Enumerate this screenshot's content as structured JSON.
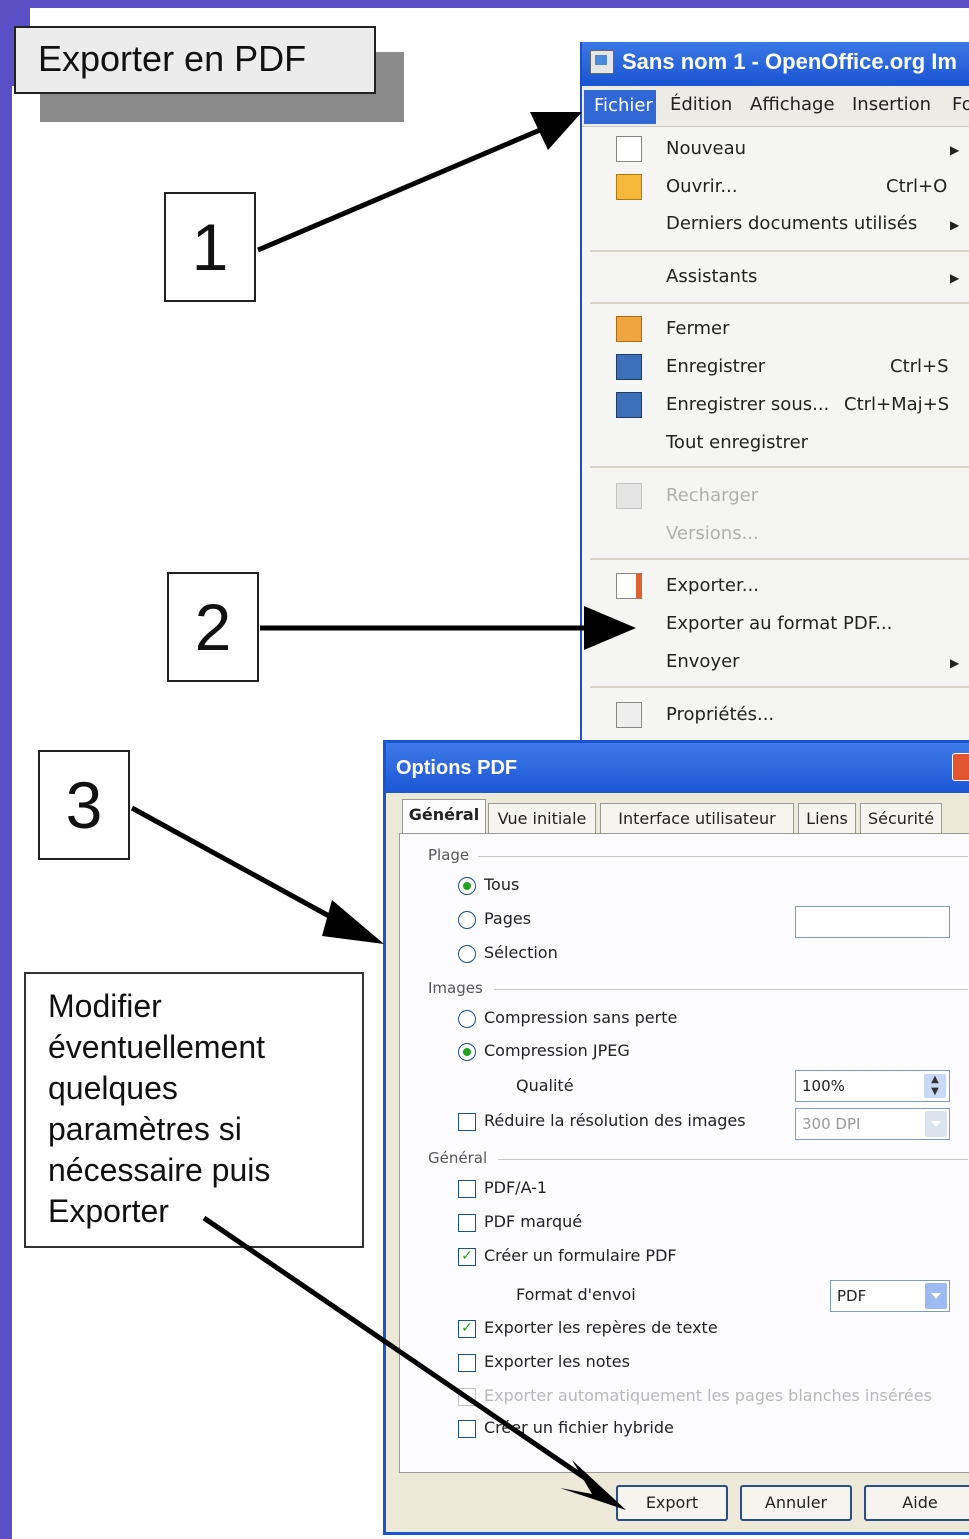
{
  "title": "Exporter en PDF",
  "steps": [
    "1",
    "2",
    "3"
  ],
  "note": [
    "Modifier",
    "éventuellement",
    "quelques",
    "paramètres si",
    "nécessaire puis",
    "Exporter"
  ],
  "window": {
    "title": "Sans nom 1 - OpenOffice.org Im",
    "menubar": [
      "Fichier",
      "Édition",
      "Affichage",
      "Insertion",
      "Fo"
    ],
    "menu": [
      {
        "label": "Nouveau",
        "submenu": true
      },
      {
        "label": "Ouvrir...",
        "shortcut": "Ctrl+O"
      },
      {
        "label": "Derniers documents utilisés",
        "submenu": true
      },
      {
        "label": "Assistants",
        "submenu": true
      },
      {
        "label": "Fermer"
      },
      {
        "label": "Enregistrer",
        "shortcut": "Ctrl+S"
      },
      {
        "label": "Enregistrer sous...",
        "shortcut": "Ctrl+Maj+S"
      },
      {
        "label": "Tout enregistrer"
      },
      {
        "label": "Recharger",
        "disabled": true
      },
      {
        "label": "Versions...",
        "disabled": true
      },
      {
        "label": "Exporter..."
      },
      {
        "label": "Exporter au format PDF..."
      },
      {
        "label": "Envoyer",
        "submenu": true
      },
      {
        "label": "Propriétés..."
      }
    ]
  },
  "dialog": {
    "title": "Options PDF",
    "tabs": [
      "Général",
      "Vue initiale",
      "Interface utilisateur",
      "Liens",
      "Sécurité"
    ],
    "plage": {
      "group": "Plage",
      "options": [
        "Tous",
        "Pages",
        "Sélection"
      ],
      "selected": "Tous"
    },
    "images": {
      "group": "Images",
      "options": [
        "Compression sans perte",
        "Compression JPEG"
      ],
      "selected": "Compression JPEG",
      "quality_label": "Qualité",
      "quality_value": "100%",
      "reduce_label": "Réduire la résolution des images",
      "reduce_checked": false,
      "dpi_value": "300 DPI"
    },
    "general": {
      "group": "Général",
      "pdfa": {
        "label": "PDF/A-1",
        "checked": false
      },
      "marked": {
        "label": "PDF marqué",
        "checked": false
      },
      "form": {
        "label": "Créer un formulaire PDF",
        "checked": true
      },
      "submit_label": "Format d'envoi",
      "submit_value": "PDF",
      "bookmarks": {
        "label": "Exporter les repères de texte",
        "checked": true
      },
      "notes": {
        "label": "Exporter les notes",
        "checked": false
      },
      "blank_pages": {
        "label": "Exporter automatiquement les pages blanches insérées",
        "checked": false,
        "disabled": true
      },
      "hybrid": {
        "label": "Créer un fichier hybride",
        "checked": false
      }
    },
    "buttons": [
      "Export",
      "Annuler",
      "Aide"
    ]
  }
}
